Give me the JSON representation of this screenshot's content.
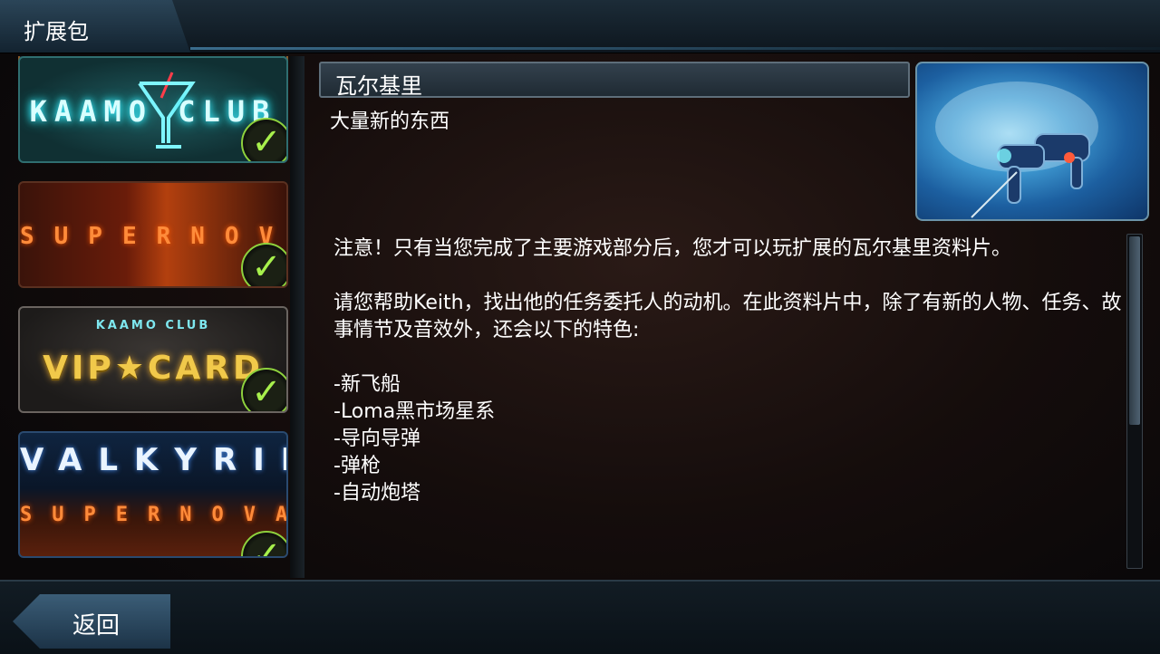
{
  "header": {
    "title": "扩展包"
  },
  "packs": [
    {
      "id": "unknown-top",
      "label": "",
      "owned": true
    },
    {
      "id": "kaamo-club",
      "label": "KAAMO CLUB",
      "owned": true
    },
    {
      "id": "supernova",
      "label": "SUPERNOVA",
      "owned": true
    },
    {
      "id": "vip-card",
      "label": "VIP★CARD",
      "small": "KAAMO CLUB",
      "owned": true
    },
    {
      "id": "valkyrie",
      "label": "VALKYRIE",
      "sub": "SUPERNOVA",
      "owned": true
    }
  ],
  "detail": {
    "name": "瓦尔基里",
    "subtitle": "大量新的东西",
    "paragraph1": "注意！只有当您完成了主要游戏部分后，您才可以玩扩展的瓦尔基里资料片。",
    "paragraph2": "请您帮助Keith，找出他的任务委托人的动机。在此资料片中，除了有新的人物、任务、故事情节及音效外，还会以下的特色:",
    "features": [
      "-新飞船",
      "-Loma黑市场星系",
      "-导向导弹",
      "-弹枪",
      "-自动炮塔"
    ]
  },
  "footer": {
    "back_label": "返回"
  },
  "colors": {
    "accent_check": "#a7f04c",
    "panel_border": "#5e6e7a"
  }
}
